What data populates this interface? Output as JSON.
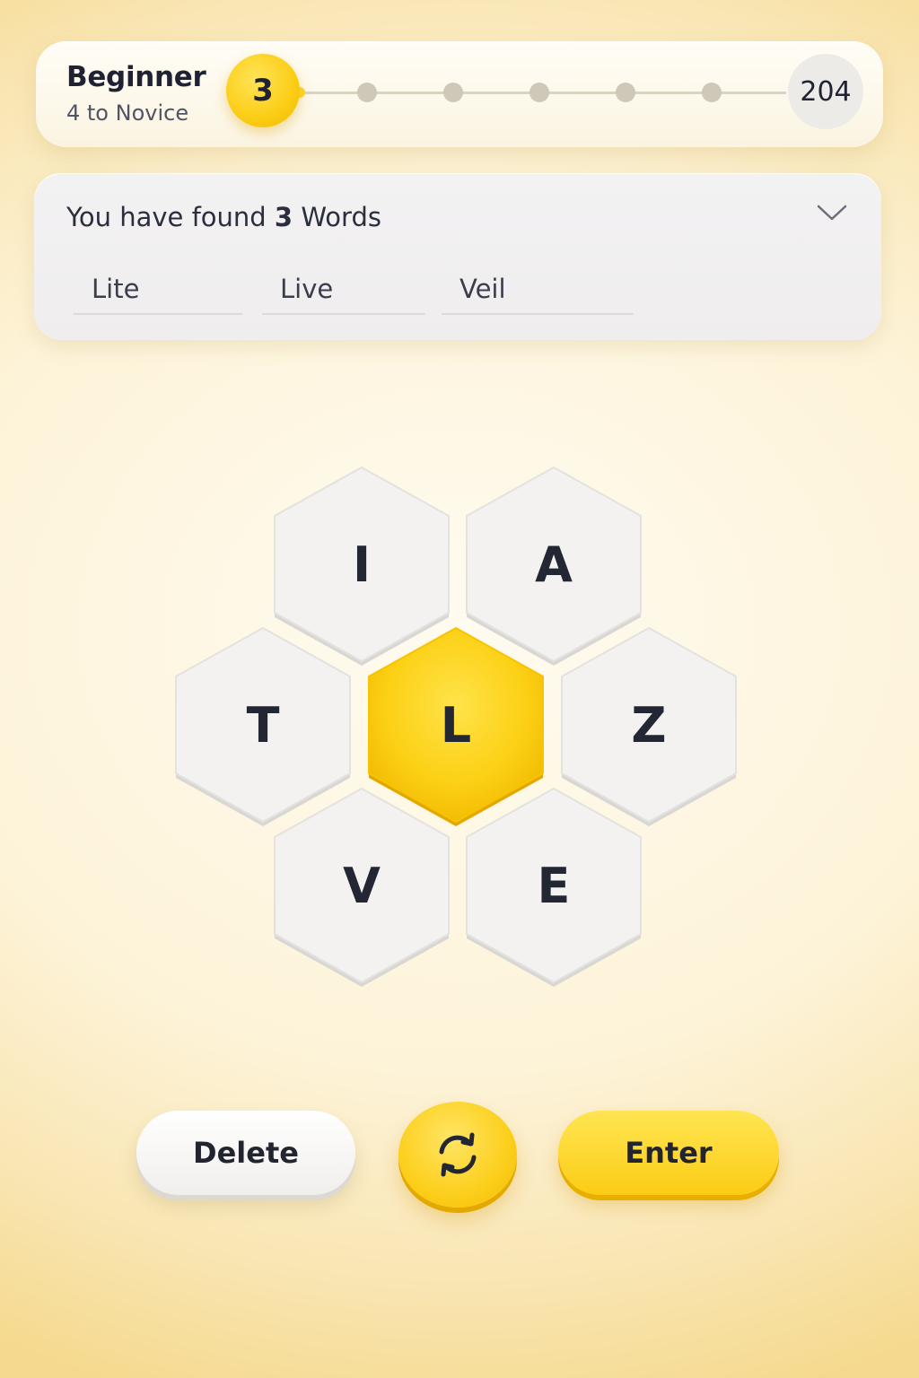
{
  "rank": {
    "title": "Beginner",
    "subtitle": "4 to Novice",
    "score": "3",
    "max_score": "204",
    "milestones": 6
  },
  "found": {
    "prefix": "You have found",
    "count": "3",
    "suffix": "Words",
    "words": [
      "Lite",
      "Live",
      "Veil"
    ],
    "expand_icon": "chevron-down-icon"
  },
  "hive": {
    "center": "L",
    "outer": {
      "top_left": "I",
      "top_right": "A",
      "left": "T",
      "right": "Z",
      "bottom_left": "V",
      "bottom_right": "E"
    },
    "center_color": "#fcd116",
    "outer_color": "#f2f1f0"
  },
  "controls": {
    "delete_label": "Delete",
    "shuffle_icon": "shuffle-icon",
    "enter_label": "Enter",
    "accent_color": "#fbcd14"
  }
}
